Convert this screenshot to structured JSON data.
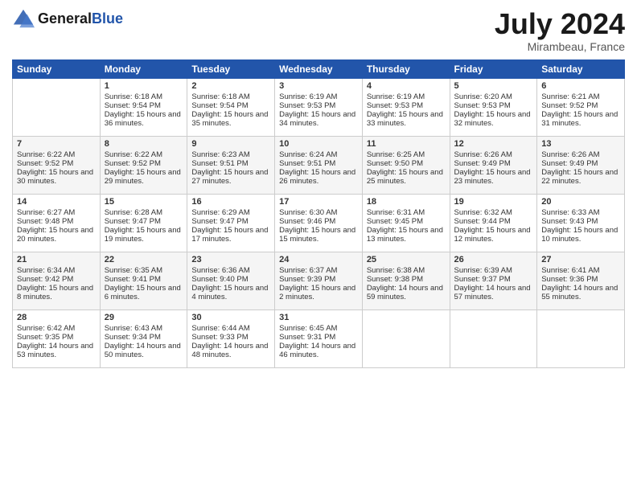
{
  "header": {
    "logo": {
      "line1": "General",
      "line2": "Blue"
    },
    "title": "July 2024",
    "location": "Mirambeau, France"
  },
  "days_of_week": [
    "Sunday",
    "Monday",
    "Tuesday",
    "Wednesday",
    "Thursday",
    "Friday",
    "Saturday"
  ],
  "weeks": [
    [
      {
        "day": null,
        "data": null
      },
      {
        "day": "1",
        "sunrise": "Sunrise: 6:18 AM",
        "sunset": "Sunset: 9:54 PM",
        "daylight": "Daylight: 15 hours and 36 minutes."
      },
      {
        "day": "2",
        "sunrise": "Sunrise: 6:18 AM",
        "sunset": "Sunset: 9:54 PM",
        "daylight": "Daylight: 15 hours and 35 minutes."
      },
      {
        "day": "3",
        "sunrise": "Sunrise: 6:19 AM",
        "sunset": "Sunset: 9:53 PM",
        "daylight": "Daylight: 15 hours and 34 minutes."
      },
      {
        "day": "4",
        "sunrise": "Sunrise: 6:19 AM",
        "sunset": "Sunset: 9:53 PM",
        "daylight": "Daylight: 15 hours and 33 minutes."
      },
      {
        "day": "5",
        "sunrise": "Sunrise: 6:20 AM",
        "sunset": "Sunset: 9:53 PM",
        "daylight": "Daylight: 15 hours and 32 minutes."
      },
      {
        "day": "6",
        "sunrise": "Sunrise: 6:21 AM",
        "sunset": "Sunset: 9:52 PM",
        "daylight": "Daylight: 15 hours and 31 minutes."
      }
    ],
    [
      {
        "day": "7",
        "sunrise": "Sunrise: 6:22 AM",
        "sunset": "Sunset: 9:52 PM",
        "daylight": "Daylight: 15 hours and 30 minutes."
      },
      {
        "day": "8",
        "sunrise": "Sunrise: 6:22 AM",
        "sunset": "Sunset: 9:52 PM",
        "daylight": "Daylight: 15 hours and 29 minutes."
      },
      {
        "day": "9",
        "sunrise": "Sunrise: 6:23 AM",
        "sunset": "Sunset: 9:51 PM",
        "daylight": "Daylight: 15 hours and 27 minutes."
      },
      {
        "day": "10",
        "sunrise": "Sunrise: 6:24 AM",
        "sunset": "Sunset: 9:51 PM",
        "daylight": "Daylight: 15 hours and 26 minutes."
      },
      {
        "day": "11",
        "sunrise": "Sunrise: 6:25 AM",
        "sunset": "Sunset: 9:50 PM",
        "daylight": "Daylight: 15 hours and 25 minutes."
      },
      {
        "day": "12",
        "sunrise": "Sunrise: 6:26 AM",
        "sunset": "Sunset: 9:49 PM",
        "daylight": "Daylight: 15 hours and 23 minutes."
      },
      {
        "day": "13",
        "sunrise": "Sunrise: 6:26 AM",
        "sunset": "Sunset: 9:49 PM",
        "daylight": "Daylight: 15 hours and 22 minutes."
      }
    ],
    [
      {
        "day": "14",
        "sunrise": "Sunrise: 6:27 AM",
        "sunset": "Sunset: 9:48 PM",
        "daylight": "Daylight: 15 hours and 20 minutes."
      },
      {
        "day": "15",
        "sunrise": "Sunrise: 6:28 AM",
        "sunset": "Sunset: 9:47 PM",
        "daylight": "Daylight: 15 hours and 19 minutes."
      },
      {
        "day": "16",
        "sunrise": "Sunrise: 6:29 AM",
        "sunset": "Sunset: 9:47 PM",
        "daylight": "Daylight: 15 hours and 17 minutes."
      },
      {
        "day": "17",
        "sunrise": "Sunrise: 6:30 AM",
        "sunset": "Sunset: 9:46 PM",
        "daylight": "Daylight: 15 hours and 15 minutes."
      },
      {
        "day": "18",
        "sunrise": "Sunrise: 6:31 AM",
        "sunset": "Sunset: 9:45 PM",
        "daylight": "Daylight: 15 hours and 13 minutes."
      },
      {
        "day": "19",
        "sunrise": "Sunrise: 6:32 AM",
        "sunset": "Sunset: 9:44 PM",
        "daylight": "Daylight: 15 hours and 12 minutes."
      },
      {
        "day": "20",
        "sunrise": "Sunrise: 6:33 AM",
        "sunset": "Sunset: 9:43 PM",
        "daylight": "Daylight: 15 hours and 10 minutes."
      }
    ],
    [
      {
        "day": "21",
        "sunrise": "Sunrise: 6:34 AM",
        "sunset": "Sunset: 9:42 PM",
        "daylight": "Daylight: 15 hours and 8 minutes."
      },
      {
        "day": "22",
        "sunrise": "Sunrise: 6:35 AM",
        "sunset": "Sunset: 9:41 PM",
        "daylight": "Daylight: 15 hours and 6 minutes."
      },
      {
        "day": "23",
        "sunrise": "Sunrise: 6:36 AM",
        "sunset": "Sunset: 9:40 PM",
        "daylight": "Daylight: 15 hours and 4 minutes."
      },
      {
        "day": "24",
        "sunrise": "Sunrise: 6:37 AM",
        "sunset": "Sunset: 9:39 PM",
        "daylight": "Daylight: 15 hours and 2 minutes."
      },
      {
        "day": "25",
        "sunrise": "Sunrise: 6:38 AM",
        "sunset": "Sunset: 9:38 PM",
        "daylight": "Daylight: 14 hours and 59 minutes."
      },
      {
        "day": "26",
        "sunrise": "Sunrise: 6:39 AM",
        "sunset": "Sunset: 9:37 PM",
        "daylight": "Daylight: 14 hours and 57 minutes."
      },
      {
        "day": "27",
        "sunrise": "Sunrise: 6:41 AM",
        "sunset": "Sunset: 9:36 PM",
        "daylight": "Daylight: 14 hours and 55 minutes."
      }
    ],
    [
      {
        "day": "28",
        "sunrise": "Sunrise: 6:42 AM",
        "sunset": "Sunset: 9:35 PM",
        "daylight": "Daylight: 14 hours and 53 minutes."
      },
      {
        "day": "29",
        "sunrise": "Sunrise: 6:43 AM",
        "sunset": "Sunset: 9:34 PM",
        "daylight": "Daylight: 14 hours and 50 minutes."
      },
      {
        "day": "30",
        "sunrise": "Sunrise: 6:44 AM",
        "sunset": "Sunset: 9:33 PM",
        "daylight": "Daylight: 14 hours and 48 minutes."
      },
      {
        "day": "31",
        "sunrise": "Sunrise: 6:45 AM",
        "sunset": "Sunset: 9:31 PM",
        "daylight": "Daylight: 14 hours and 46 minutes."
      },
      {
        "day": null,
        "data": null
      },
      {
        "day": null,
        "data": null
      },
      {
        "day": null,
        "data": null
      }
    ]
  ]
}
